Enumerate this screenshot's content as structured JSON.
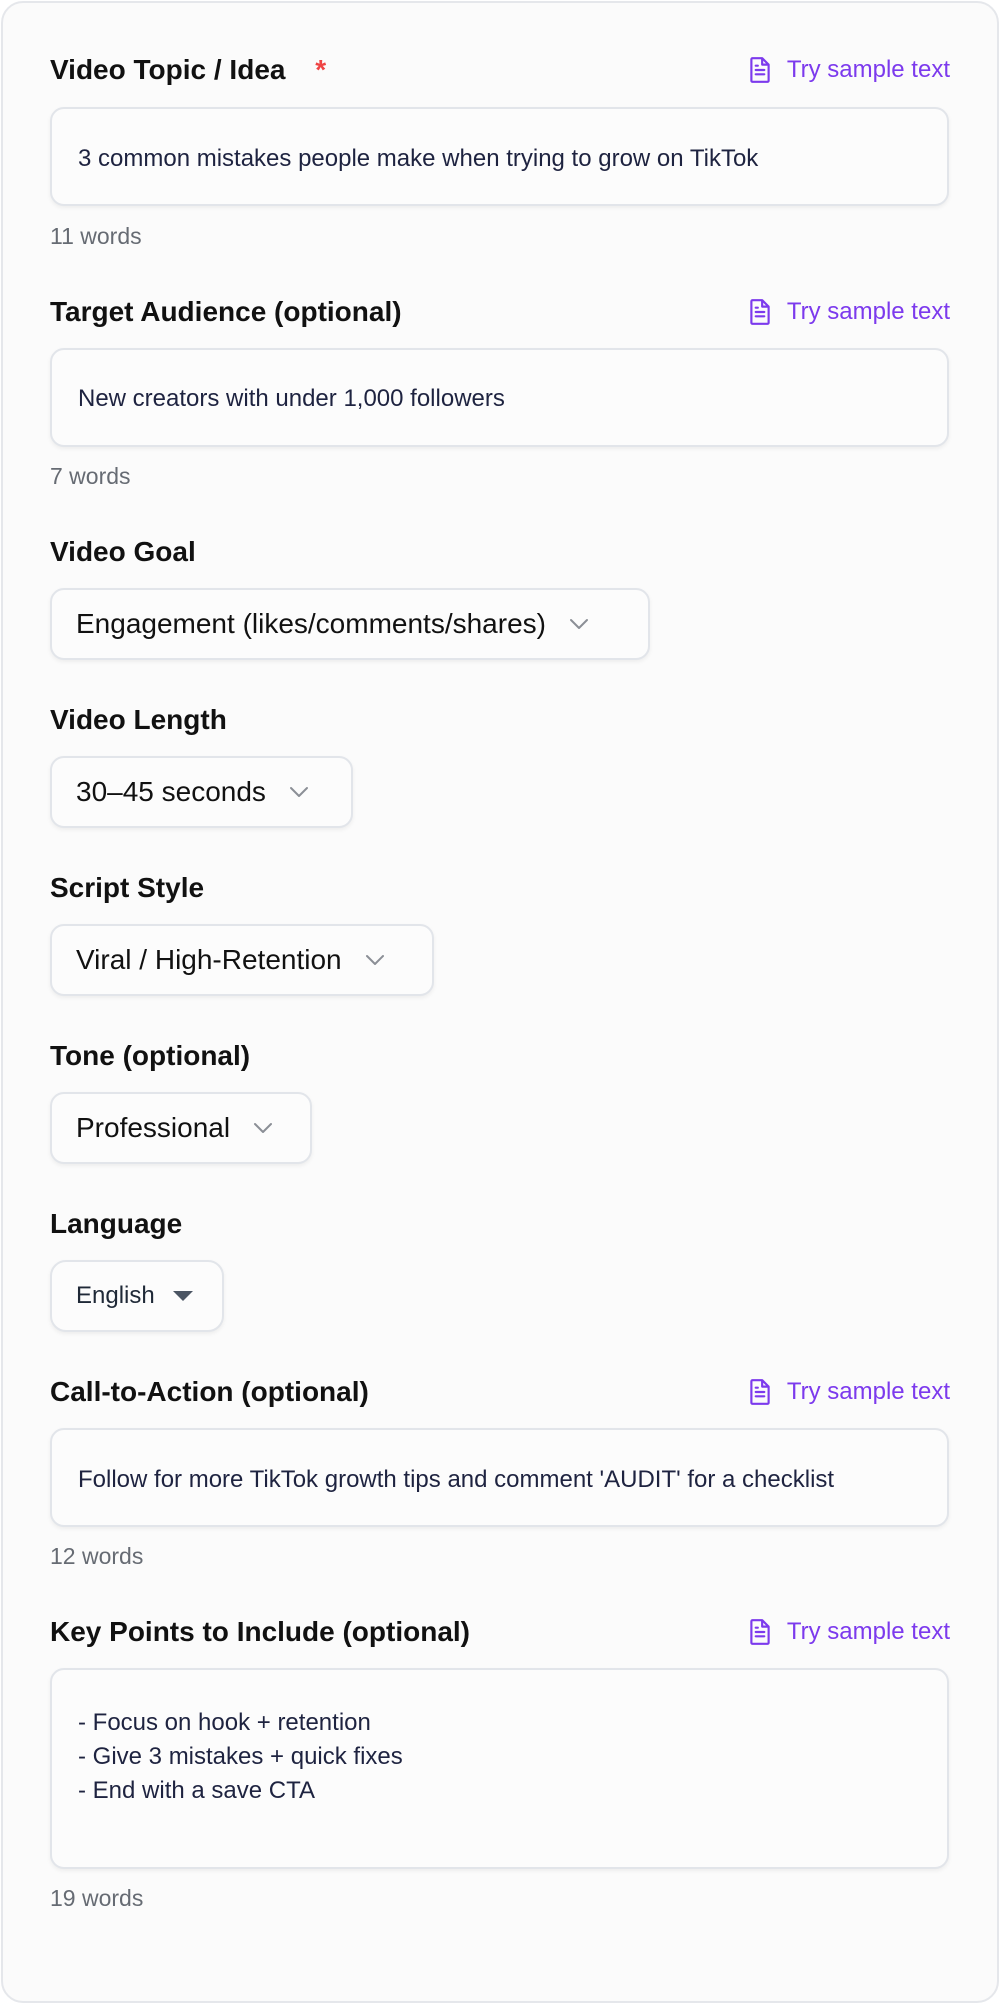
{
  "sample_label": "Try sample text",
  "topic": {
    "label": "Video Topic / Idea",
    "required_mark": "*",
    "value": "3 common mistakes people make when trying to grow on TikTok",
    "count": "11 words"
  },
  "audience": {
    "label": "Target Audience (optional)",
    "value": "New creators with under 1,000 followers",
    "count": "7 words"
  },
  "goal": {
    "label": "Video Goal",
    "value": "Engagement (likes/comments/shares)"
  },
  "length": {
    "label": "Video Length",
    "value": "30–45 seconds"
  },
  "style": {
    "label": "Script Style",
    "value": "Viral / High-Retention"
  },
  "tone": {
    "label": "Tone (optional)",
    "value": "Professional"
  },
  "language": {
    "label": "Language",
    "value": "English"
  },
  "cta": {
    "label": "Call-to-Action (optional)",
    "value": "Follow for more TikTok growth tips and comment 'AUDIT' for a checklist",
    "count": "12 words"
  },
  "key_points": {
    "label": "Key Points to Include (optional)",
    "value": "- Focus on hook + retention\n- Give 3 mistakes + quick fixes\n- End with a save CTA",
    "count": "19 words"
  },
  "colors": {
    "accent": "#7c3aed",
    "required": "#ef4444",
    "border": "#e2e5ea"
  },
  "icons": {
    "sample": "document-icon",
    "select": "chevron-down-icon",
    "language": "caret-down-icon"
  }
}
